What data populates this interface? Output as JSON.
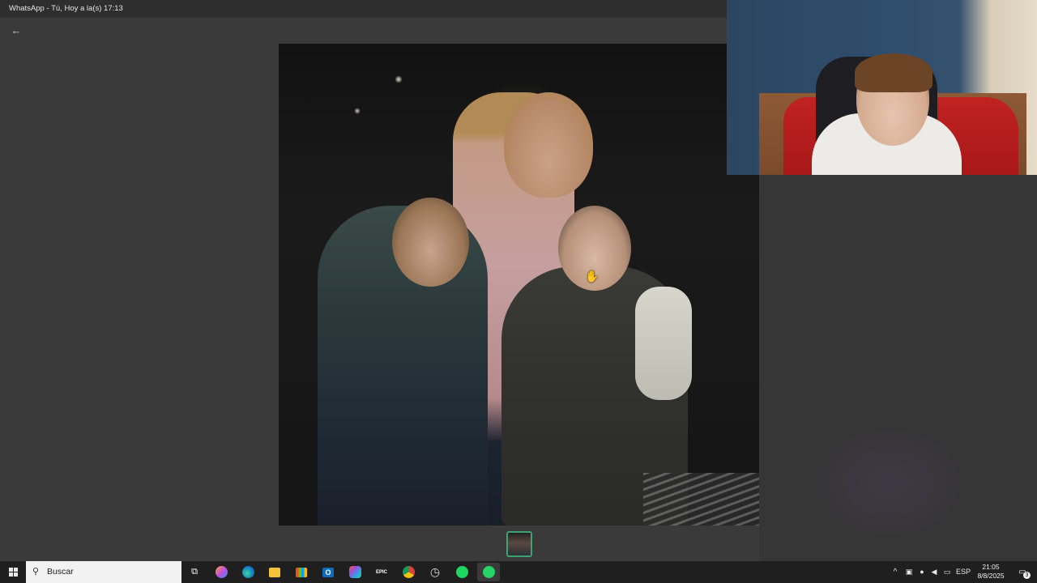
{
  "window": {
    "title": "WhatsApp - Tú, Hoy a la(s) 17:13"
  },
  "viewer": {
    "back_icon": "←",
    "thumbnail_count": 1,
    "cursor_icon": "✋"
  },
  "taskbar": {
    "search_placeholder": "Buscar",
    "search_icon": "⚲",
    "apps": [
      {
        "name": "task-view",
        "glyph": "⧉"
      },
      {
        "name": "copilot",
        "glyph": ""
      },
      {
        "name": "edge",
        "glyph": ""
      },
      {
        "name": "file-explorer",
        "glyph": ""
      },
      {
        "name": "microsoft-store",
        "glyph": ""
      },
      {
        "name": "outlook",
        "glyph": "O"
      },
      {
        "name": "microsoft-365",
        "glyph": ""
      },
      {
        "name": "epic-games",
        "glyph": "EPIC"
      },
      {
        "name": "chrome",
        "glyph": ""
      },
      {
        "name": "clock-app",
        "glyph": "◷"
      },
      {
        "name": "spotify",
        "glyph": ""
      },
      {
        "name": "whatsapp",
        "glyph": ""
      }
    ],
    "tray": {
      "chevron": "^",
      "language": "ESP",
      "time": "21:05",
      "date": "8/8/2025",
      "notification_count": "3"
    }
  },
  "colors": {
    "accent": "#3ea371",
    "whatsapp": "#25d366",
    "spotify": "#1ed760",
    "taskbar": "#1f1f1f"
  }
}
